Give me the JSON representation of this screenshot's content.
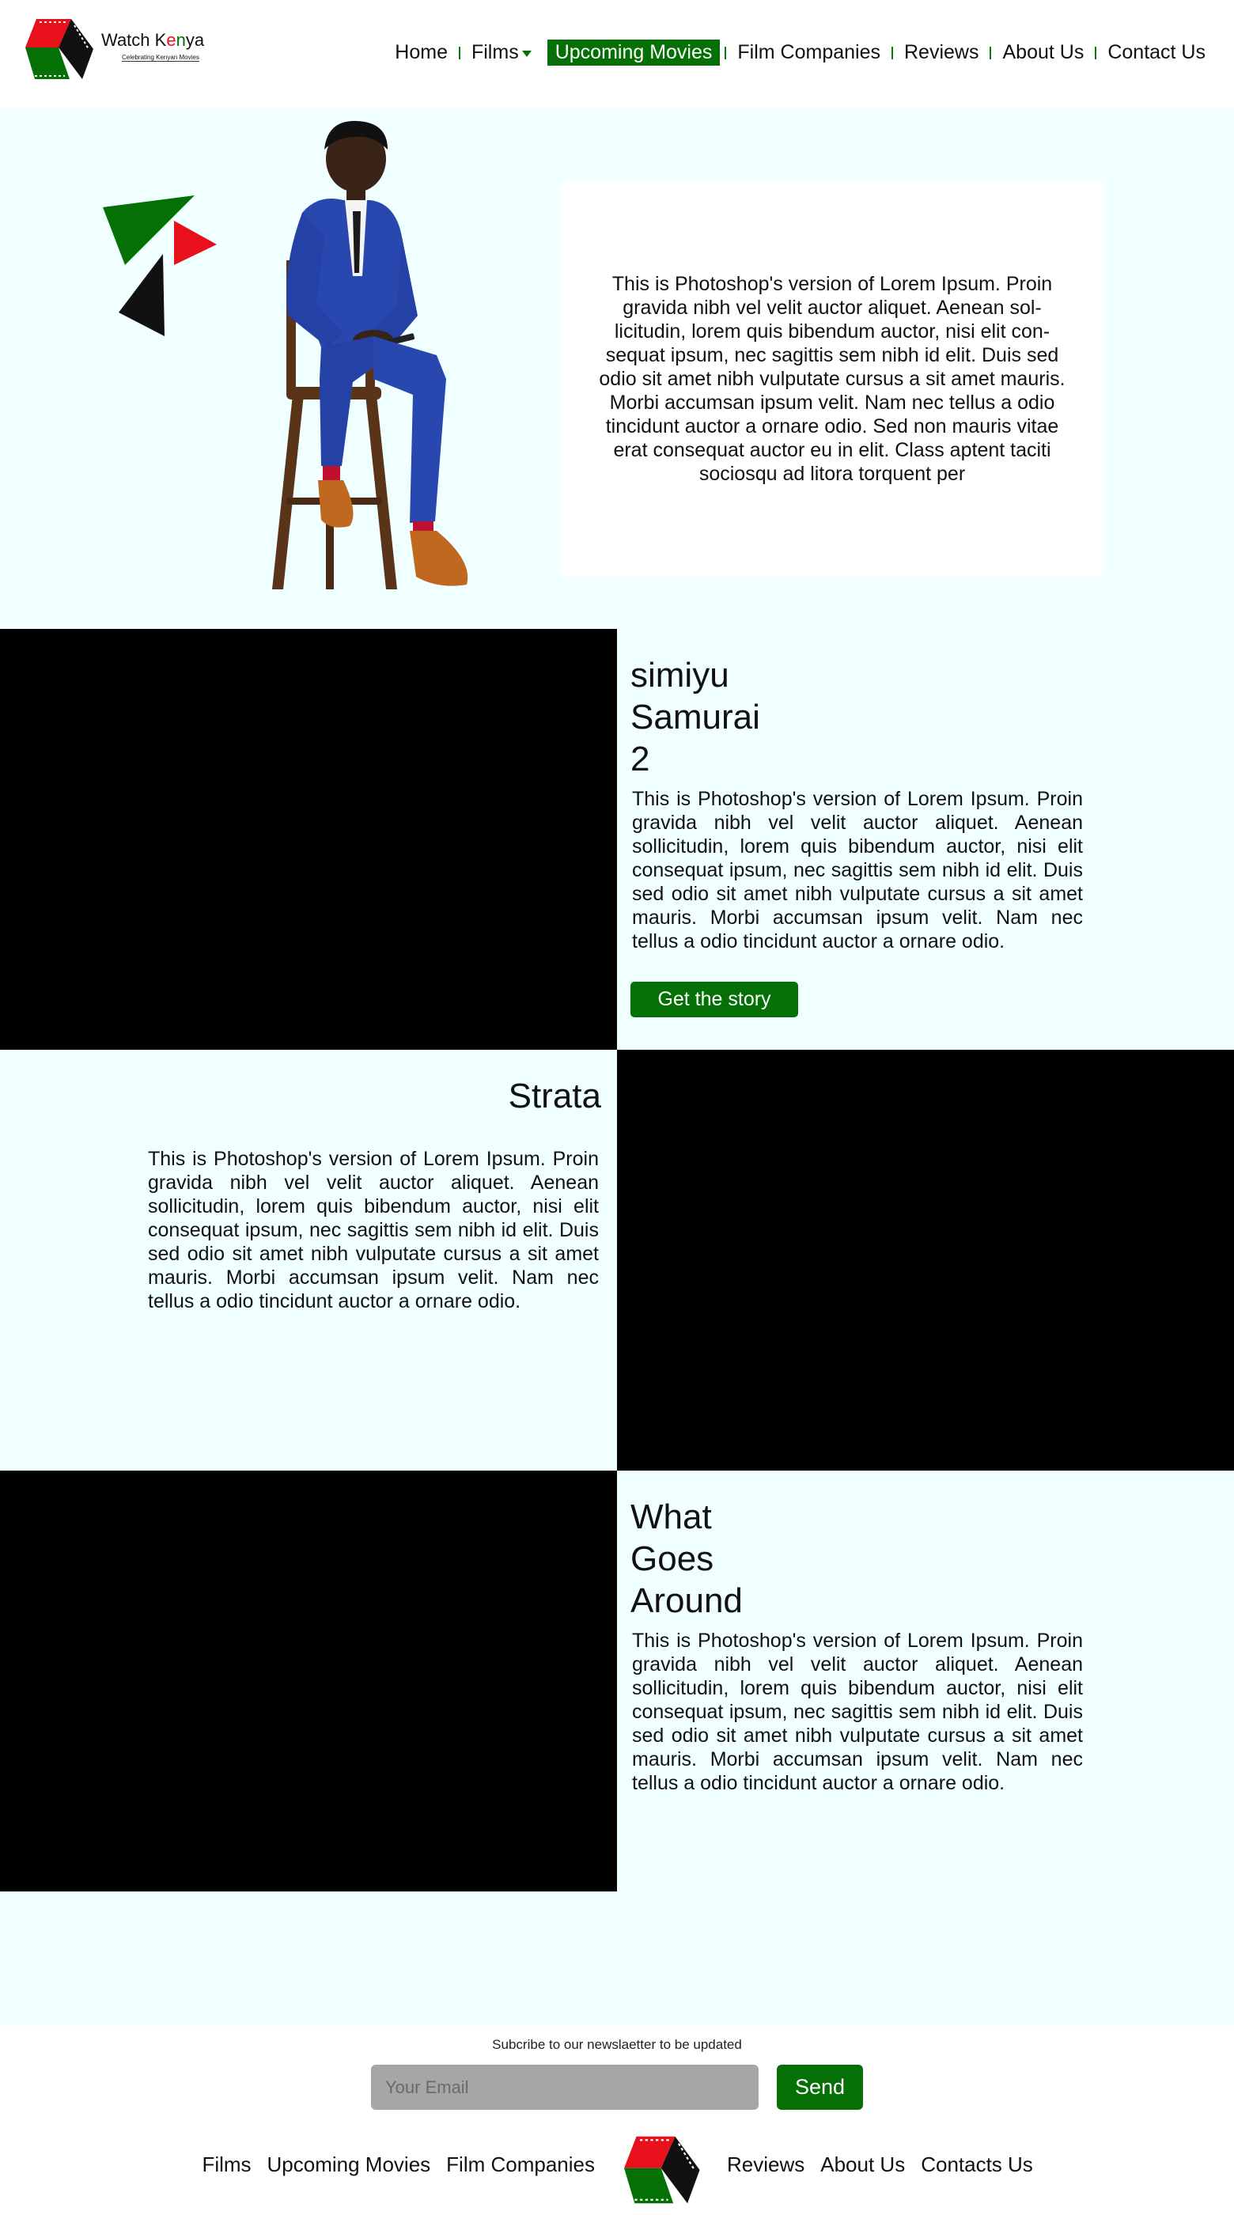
{
  "header": {
    "logo_title_a": "Watch K",
    "logo_title_e": "e",
    "logo_title_n": "n",
    "logo_title_y": "ya",
    "logo_subtitle": "Celebrating Kenyan Movies",
    "nav": [
      {
        "label": "Home"
      },
      {
        "label": "Films"
      },
      {
        "label": "Upcoming Movies"
      },
      {
        "label": "Film Companies"
      },
      {
        "label": "Reviews"
      },
      {
        "label": "About Us"
      },
      {
        "label": "Contact Us"
      }
    ]
  },
  "hero": {
    "text": "This is Photoshop's version  of Lorem Ipsum. Proin gravida nibh vel velit auctor aliquet. Aenean sol-licitudin, lorem quis bibendum auctor, nisi elit con-sequat ipsum, nec sagittis sem nibh id elit. Duis sed odio sit amet nibh vulputate cursus a sit amet mauris. Morbi accumsan ipsum velit. Nam nec tellus a odio tincidunt auctor a ornare odio. Sed non  mauris vitae erat consequat auctor eu in elit. Class aptent taciti sociosqu ad litora torquent per"
  },
  "films": [
    {
      "title": "simiyu Samurai 2",
      "body": "This is Photoshop's version  of Lorem Ipsum. Proin gravida nibh vel velit auctor aliquet. Aenean sollicitudin, lorem quis bibendum auctor, nisi elit consequat ipsum, nec sagittis sem nibh id elit. Duis sed odio sit amet nibh vulputate cursus a sit amet mauris. Morbi accumsan ipsum velit. Nam nec tellus a odio tincidunt auctor a ornare odio.",
      "button": "Get the story"
    },
    {
      "title": "Strata",
      "body": "This is Photoshop's version  of Lorem Ipsum. Proin gravida nibh vel velit auctor aliquet. Aenean sollicitudin, lorem quis bibendum auctor, nisi elit consequat ipsum, nec sagittis sem nibh id elit. Duis sed odio sit amet nibh vulputate cursus a sit amet mauris. Morbi accumsan ipsum velit. Nam nec tellus a odio tincidunt auctor a ornare odio."
    },
    {
      "title": "What Goes Around",
      "body": "This is Photoshop's version  of Lorem Ipsum. Proin gravida nibh vel velit auctor aliquet. Aenean sollicitudin, lorem quis bibendum auctor, nisi elit consequat ipsum, nec sagittis sem nibh id elit. Duis sed odio sit amet nibh vulputate cursus a sit amet mauris. Morbi accumsan ipsum velit. Nam nec tellus a odio tincidunt auctor a ornare odio."
    }
  ],
  "footer": {
    "newsletter_label": "Subcribe to our newslaetter to be updated",
    "email_placeholder": "Your Email",
    "send_label": "Send",
    "nav_left": [
      "Films",
      "Upcoming Movies",
      "Film Companies"
    ],
    "nav_right": [
      "Reviews",
      "About Us",
      "Contacts Us"
    ]
  },
  "colors": {
    "brand_green": "#057005",
    "brand_red": "#e8101a",
    "page_bg": "#f0ffff"
  }
}
